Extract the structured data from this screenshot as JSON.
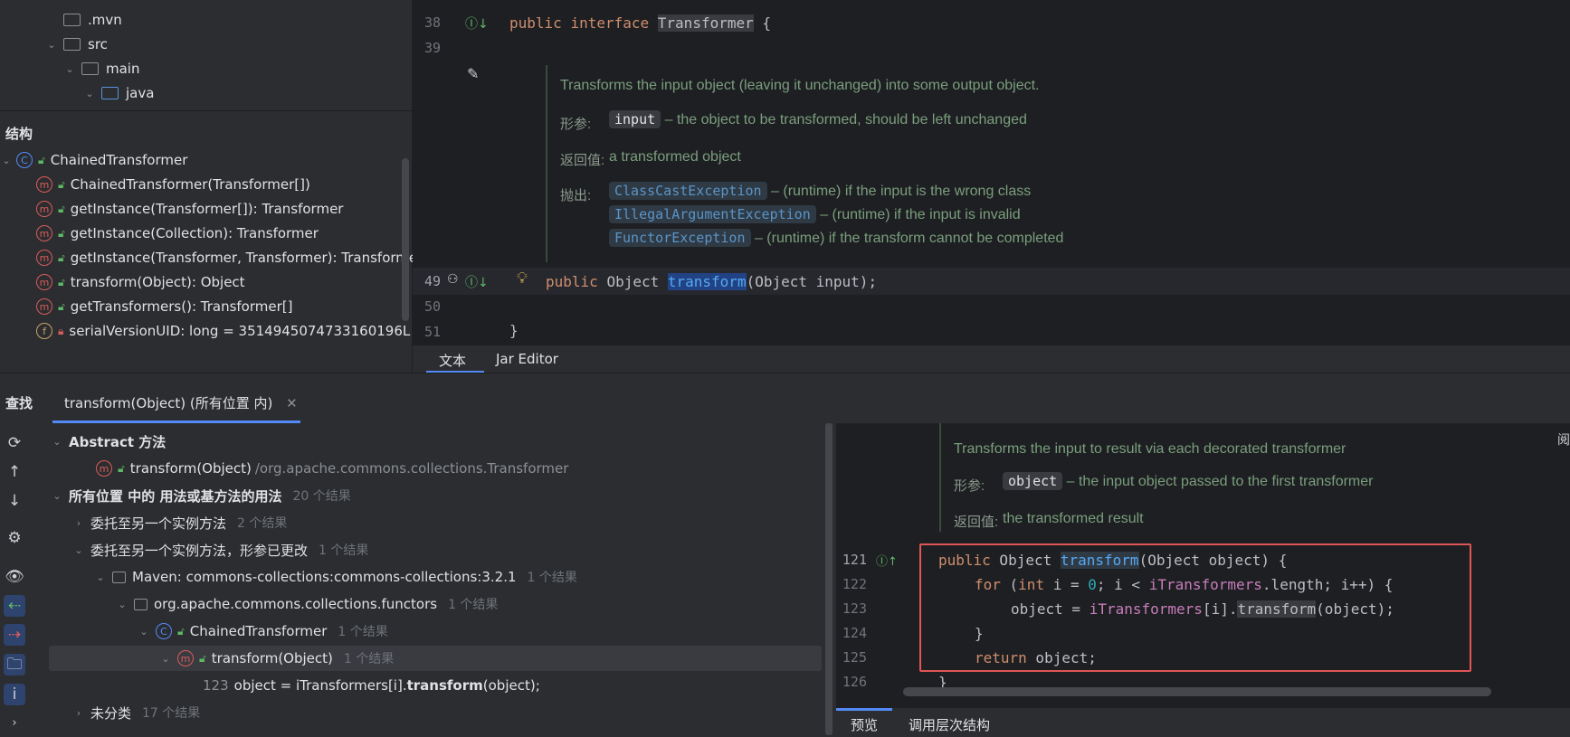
{
  "project_tree": {
    "items": [
      {
        "label": ".mvn",
        "expanded": false
      },
      {
        "label": "src",
        "expanded": true
      },
      {
        "label": "main",
        "expanded": true
      },
      {
        "label": "java",
        "expanded": true
      }
    ]
  },
  "structure": {
    "title": "结构",
    "class_name": "ChainedTransformer",
    "members": [
      "ChainedTransformer(Transformer[])",
      "getInstance(Transformer[]): Transformer",
      "getInstance(Collection): Transformer",
      "getInstance(Transformer, Transformer): Transforme",
      "transform(Object): Object",
      "getTransformers(): Transformer[]",
      "serialVersionUID: long = 3514945074733160196L"
    ]
  },
  "editor": {
    "lines": {
      "l38": "38",
      "l39": "39",
      "l49": "49",
      "l50": "50",
      "l51": "51"
    },
    "code": {
      "kw_public": "public",
      "kw_interface": "interface",
      "interface_name": "Transformer",
      "brace_open": "{",
      "method_public": "public",
      "method_type": "Object",
      "method_name": "transform",
      "method_rest": "(Object input);",
      "brace_close": "}"
    },
    "doc": {
      "summary": "Transforms the input object (leaving it unchanged) into some output object.",
      "params_label": "形参:",
      "param_name": "input",
      "param_desc": "– the object to be transformed, should be left unchanged",
      "returns_label": "返回值:",
      "returns_desc": "a transformed object",
      "throws_label": "抛出:",
      "throws": [
        {
          "name": "ClassCastException",
          "desc": "– (runtime) if the input is the wrong class"
        },
        {
          "name": "IllegalArgumentException",
          "desc": "– (runtime) if the input is invalid"
        },
        {
          "name": "FunctorException",
          "desc": "– (runtime) if the transform cannot be completed"
        }
      ]
    },
    "tabs": {
      "text": "文本",
      "jar_editor": "Jar Editor"
    }
  },
  "find": {
    "title": "查找",
    "tab_label": "transform(Object) (所有位置 内)",
    "abstract_group": "Abstract 方法",
    "abstract_item": "transform(Object)",
    "abstract_item_path": "/org.apache.commons.collections.Transformer",
    "usages_group": "所有位置 中的 用法或基方法的用法",
    "usages_count": "20 个结果",
    "delegate_group": "委托至另一个实例方法",
    "delegate_count": "2 个结果",
    "delegate_changed_group": "委托至另一个实例方法，形参已更改",
    "delegate_changed_count": "1 个结果",
    "maven_item": "Maven: commons-collections:commons-collections:3.2.1",
    "maven_count": "1 个结果",
    "package_item": "org.apache.commons.collections.functors",
    "package_count": "1 个结果",
    "class_item": "ChainedTransformer",
    "class_count": "1 个结果",
    "method_item": "transform(Object)",
    "method_count": "1 个结果",
    "usage_line_no": "123",
    "usage_line_prefix": "object = iTransformers[i].",
    "usage_line_match": "transform",
    "usage_line_suffix": "(object);",
    "uncategorized": "未分类",
    "uncategorized_count": "17 个结果"
  },
  "preview": {
    "doc_summary": "Transforms the input to result via each decorated transformer",
    "params_label": "形参:",
    "param_name": "object",
    "param_desc": "– the input object passed to the first transformer",
    "returns_label": "返回值:",
    "returns_desc": "the transformed result",
    "line_numbers": [
      "121",
      "122",
      "123",
      "124",
      "125",
      "126"
    ],
    "reader_mode": "阅",
    "tabs": {
      "preview": "预览",
      "call_hierarchy": "调用层次结构"
    }
  },
  "colors": {
    "highlight_box": "#e05555",
    "selection": "#214283"
  }
}
